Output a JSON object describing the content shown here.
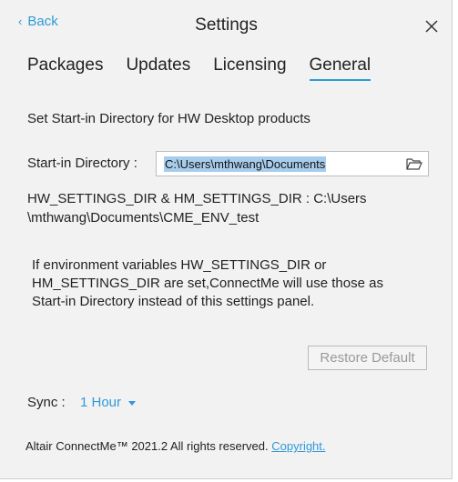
{
  "header": {
    "back_label": "Back",
    "title": "Settings"
  },
  "tabs": [
    {
      "label": "Packages",
      "active": false
    },
    {
      "label": "Updates",
      "active": false
    },
    {
      "label": "Licensing",
      "active": false
    },
    {
      "label": "General",
      "active": true
    }
  ],
  "general": {
    "section_title": "Set Start-in Directory for HW Desktop products",
    "dir_label": "Start-in Directory :",
    "dir_value": "C:\\Users\\mthwang\\Documents",
    "env_line_1": "HW_SETTINGS_DIR & HM_SETTINGS_DIR : C:\\Users",
    "env_line_2": "\\mthwang\\Documents\\CME_ENV_test",
    "info_line_1": "If environment variables HW_SETTINGS_DIR or",
    "info_line_2": "HM_SETTINGS_DIR are set,ConnectMe will use those as",
    "info_line_3": "Start-in Directory instead of this settings panel.",
    "restore_label": "Restore Default",
    "sync_label": "Sync :",
    "sync_value": "1 Hour"
  },
  "footer": {
    "text": "Altair ConnectMe™ 2021.2 All rights reserved.",
    "link_label": "Copyright."
  },
  "icons": {
    "back": "chevron-left-icon",
    "close": "close-icon",
    "folder": "folder-open-icon",
    "sync_caret": "caret-down-icon"
  },
  "colors": {
    "accent": "#2f9ad8",
    "background": "#f2f2f2",
    "selection": "#a8cdec"
  }
}
